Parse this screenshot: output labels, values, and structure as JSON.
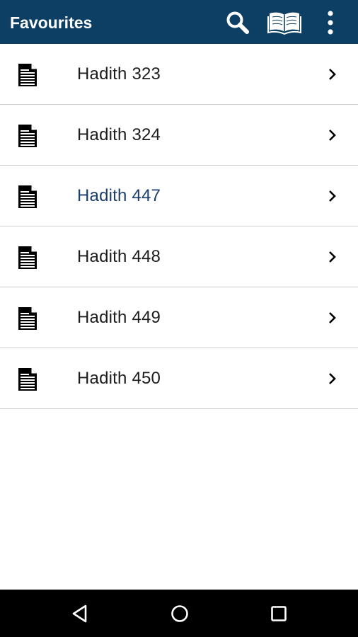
{
  "appbar": {
    "title": "Favourites",
    "background_color": "#0c3f63",
    "actions": [
      {
        "name": "search",
        "icon": "search-icon"
      },
      {
        "name": "book",
        "icon": "open-book-icon"
      },
      {
        "name": "more",
        "icon": "more-vertical-icon"
      }
    ]
  },
  "favourites": [
    {
      "label": "Hadith 323",
      "icon": "document-icon",
      "highlighted": false
    },
    {
      "label": "Hadith 324",
      "icon": "document-icon",
      "highlighted": false
    },
    {
      "label": "Hadith 447",
      "icon": "document-icon",
      "highlighted": true
    },
    {
      "label": "Hadith 448",
      "icon": "document-icon",
      "highlighted": false
    },
    {
      "label": "Hadith 449",
      "icon": "document-icon",
      "highlighted": false
    },
    {
      "label": "Hadith 450",
      "icon": "document-icon",
      "highlighted": false
    }
  ],
  "colors": {
    "highlighted_text": "#1b3e6c",
    "text": "#1c1c1c",
    "divider": "#cfcfcf"
  },
  "navbar": {
    "buttons": [
      {
        "name": "back",
        "icon": "back-triangle-icon"
      },
      {
        "name": "home",
        "icon": "home-circle-icon"
      },
      {
        "name": "recents",
        "icon": "recents-square-icon"
      }
    ]
  }
}
